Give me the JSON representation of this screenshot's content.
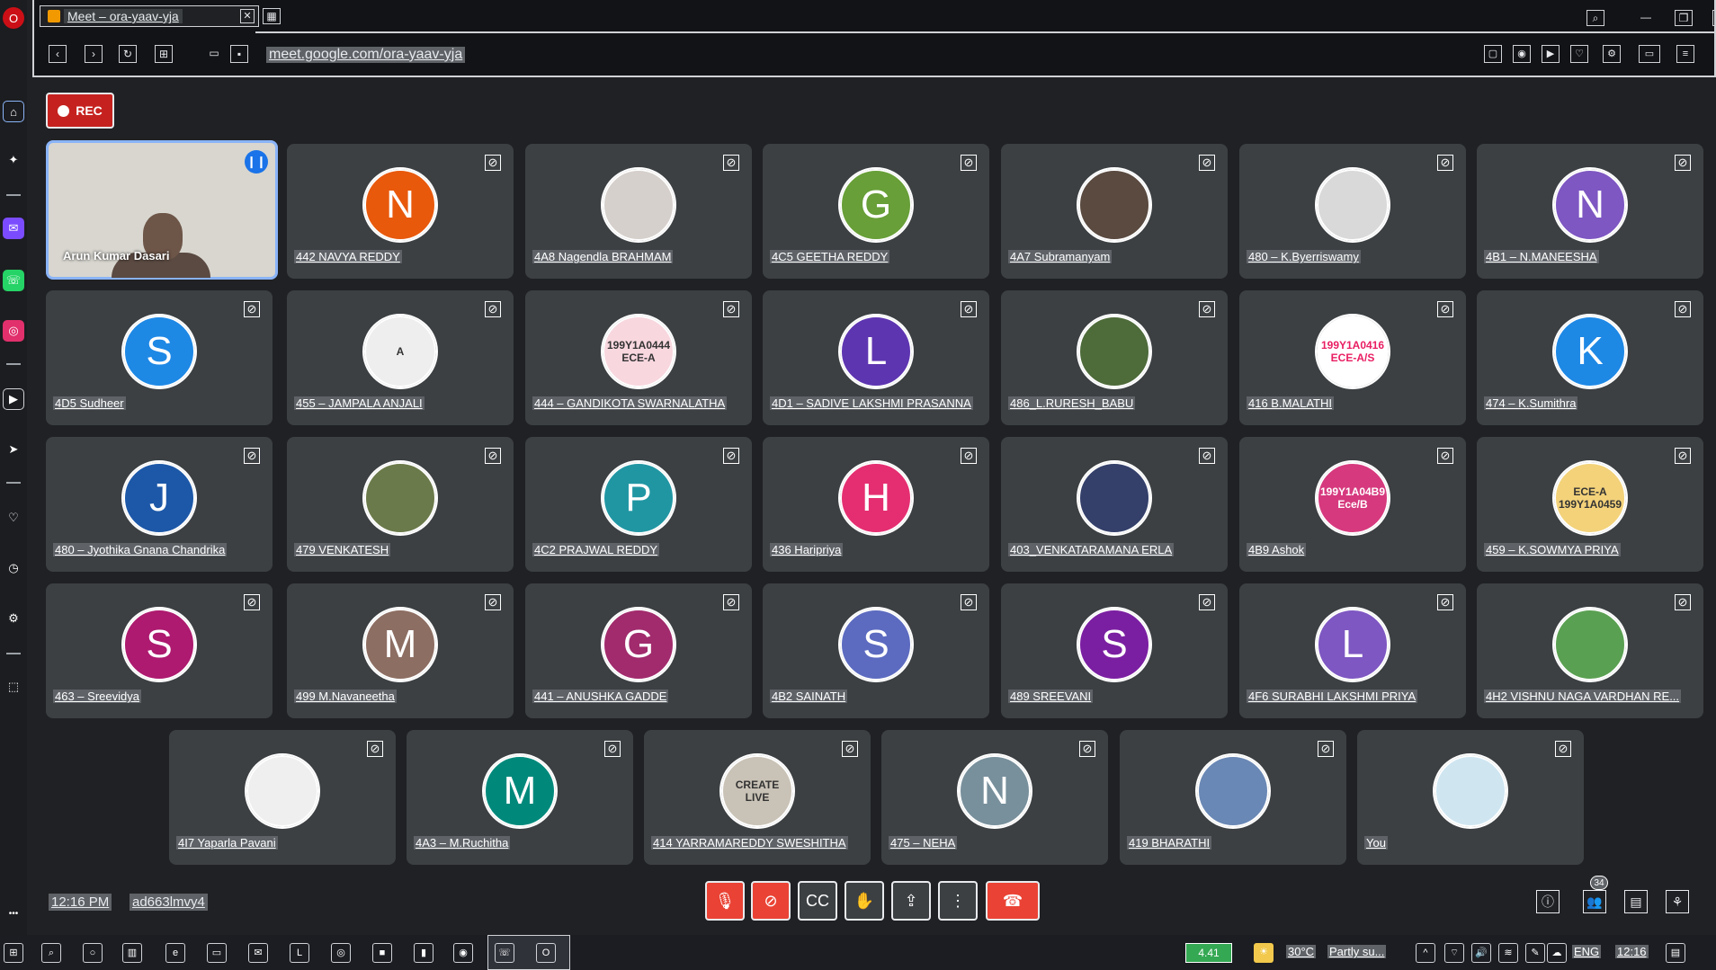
{
  "browser": {
    "tab_title": "Meet – ora-yaav-yja",
    "url": "meet.google.com/ora-yaav-yja"
  },
  "recording": {
    "label": "REC"
  },
  "self_tile": {
    "name": "Arun Kumar Dasari"
  },
  "participants": [
    {
      "name": "442 NAVYA REDDY",
      "initial": "N",
      "color": "#e8590c"
    },
    {
      "name": "4A8 Nagendla BRAHMAM",
      "initial": "",
      "color": "#d6d0cc",
      "photo": true
    },
    {
      "name": "4C5 GEETHA REDDY",
      "initial": "G",
      "color": "#689f38"
    },
    {
      "name": "4A7 Subramanyam",
      "initial": "",
      "color": "#5a4a40",
      "photo": true
    },
    {
      "name": "480 – K.Byerriswamy",
      "initial": "",
      "color": "#d9d9d9",
      "photo": true
    },
    {
      "name": "4B1 – N.MANEESHA",
      "initial": "N",
      "color": "#7e57c2"
    },
    {
      "name": "4D5 Sudheer",
      "initial": "S",
      "color": "#1e88e5"
    },
    {
      "name": "455 – JAMPALA ANJALI",
      "initial": "A",
      "color": "#eeeeee",
      "photo": true,
      "dark": true
    },
    {
      "name": "444 – GANDIKOTA SWARNALATHA",
      "initial": "199Y1A0444 ECE-A",
      "color": "#f8d7df",
      "photo": true,
      "dark": true
    },
    {
      "name": "4D1 – SADIVE LAKSHMI PRASANNA",
      "initial": "L",
      "color": "#5e35b1"
    },
    {
      "name": "486_L.RURESH_BABU",
      "initial": "",
      "color": "#4e6b3a",
      "photo": true
    },
    {
      "name": "416 B.MALATHI",
      "initial": "199Y1A0416 ECE-A/S",
      "color": "#ffffff",
      "photo": true,
      "pink": true
    },
    {
      "name": "474 – K.Sumithra",
      "initial": "K",
      "color": "#1e88e5"
    },
    {
      "name": "480 – Jyothika Gnana Chandrika",
      "initial": "J",
      "color": "#1d58a8"
    },
    {
      "name": "479 VENKATESH",
      "initial": "",
      "color": "#6b7a4a",
      "photo": true
    },
    {
      "name": "4C2 PRAJWAL REDDY",
      "initial": "P",
      "color": "#2196a3"
    },
    {
      "name": "436 Haripriya",
      "initial": "H",
      "color": "#e52e71"
    },
    {
      "name": "403_VENKATARAMANA ERLA",
      "initial": "",
      "color": "#34406a",
      "photo": true
    },
    {
      "name": "4B9 Ashok",
      "initial": "199Y1A04B9 Ece/B",
      "color": "#d6397e",
      "photo": true
    },
    {
      "name": "459 – K.SOWMYA PRIYA",
      "initial": "ECE-A 199Y1A0459",
      "color": "#f3d27a",
      "photo": true,
      "dark": true
    },
    {
      "name": "463 – Sreevidya",
      "initial": "S",
      "color": "#ad1a6f"
    },
    {
      "name": "499 M.Navaneetha",
      "initial": "M",
      "color": "#8d6e63"
    },
    {
      "name": "441 – ANUSHKA GADDE",
      "initial": "G",
      "color": "#a12b6d"
    },
    {
      "name": "4B2 SAINATH",
      "initial": "S",
      "color": "#5c6bc0"
    },
    {
      "name": "489 SREEVANI",
      "initial": "S",
      "color": "#7b1fa2"
    },
    {
      "name": "4F6 SURABHI LAKSHMI PRIYA",
      "initial": "L",
      "color": "#7e57c2"
    },
    {
      "name": "4H2 VISHNU NAGA VARDHAN RE...",
      "initial": "",
      "color": "#5aa052",
      "photo": true
    },
    {
      "name": "4I7 Yaparla Pavani",
      "initial": "",
      "color": "#efefef",
      "photo": true
    },
    {
      "name": "4A3 – M.Ruchitha",
      "initial": "M",
      "color": "#00897b"
    },
    {
      "name": "414 YARRAMAREDDY SWESHITHA",
      "initial": "CREATE LIVE",
      "color": "#c9c2b6",
      "photo": true,
      "dark": true
    },
    {
      "name": "475 – NEHA",
      "initial": "N",
      "color": "#78909c"
    },
    {
      "name": "419 BHARATHI",
      "initial": "",
      "color": "#6a88b5",
      "photo": true
    },
    {
      "name": "You",
      "initial": "",
      "color": "#cfe6f1",
      "photo": true
    }
  ],
  "bottom_bar": {
    "time": "12:16 PM",
    "meeting_code": "ad663lmvy4",
    "participant_count": "34"
  },
  "taskbar": {
    "battery": "4.41",
    "temperature": "30°C",
    "weather": "Partly su...",
    "language": "ENG",
    "clock": "12:16"
  }
}
